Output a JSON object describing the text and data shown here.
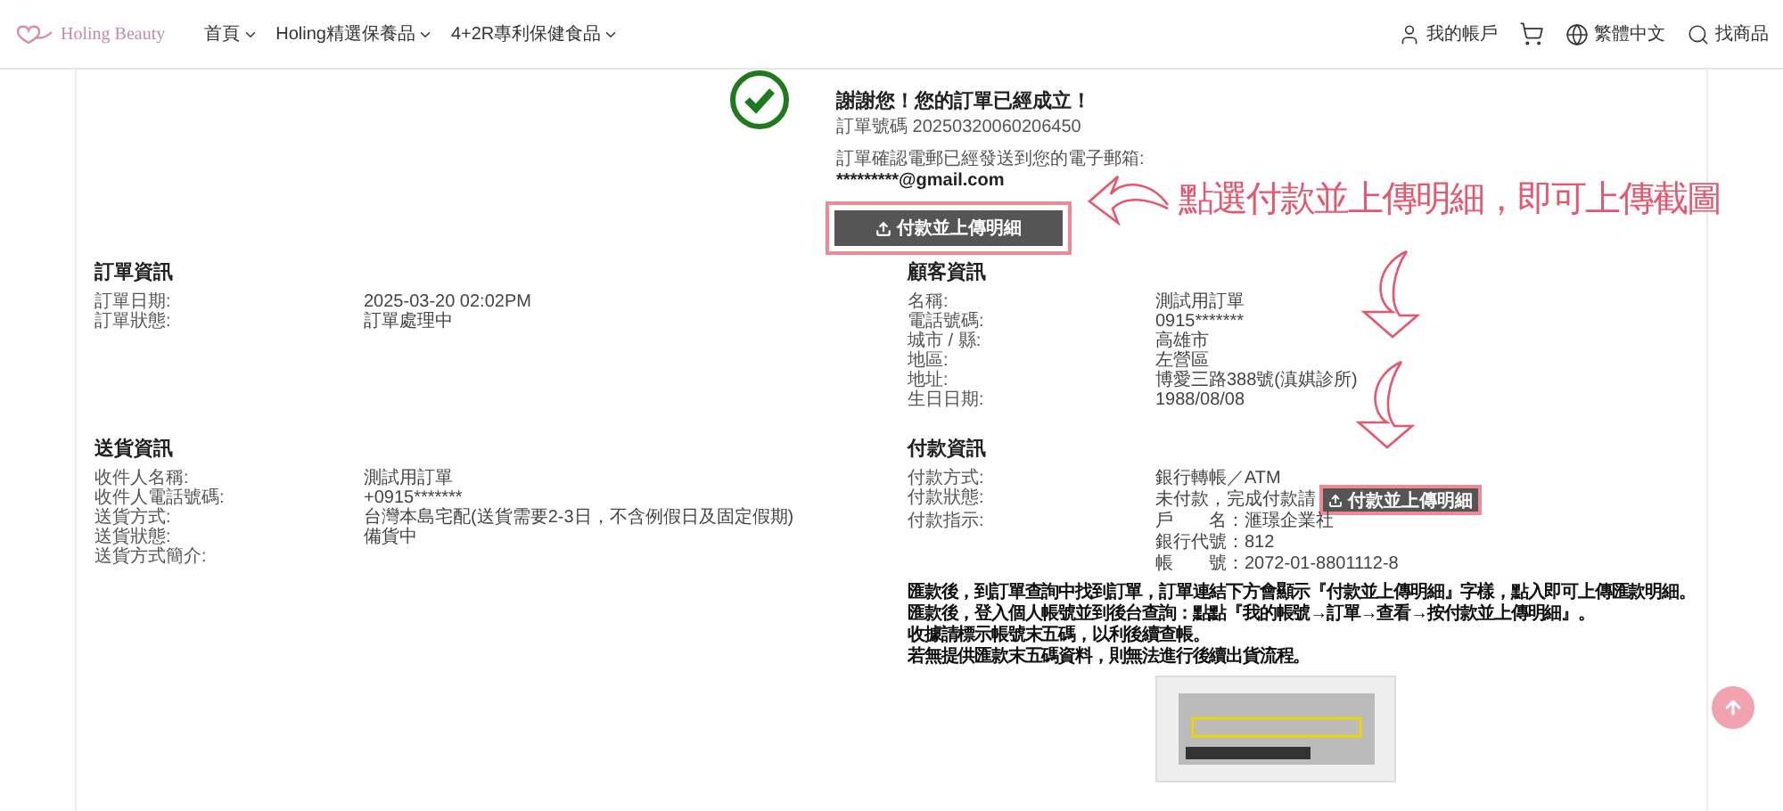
{
  "header": {
    "logo": "Holing Beauty",
    "nav": [
      {
        "label": "首頁",
        "has_menu": true
      },
      {
        "label": "Holing精選保養品",
        "has_menu": true
      },
      {
        "label": "4+2R專利保健食品",
        "has_menu": true
      }
    ],
    "actions": [
      {
        "kind": "account",
        "label": "我的帳戶"
      },
      {
        "kind": "cart"
      },
      {
        "kind": "language",
        "label": "繁體中文"
      },
      {
        "kind": "search",
        "label": "找商品"
      }
    ]
  },
  "confirmation": {
    "title": "謝謝您！您的訂單已經成立！",
    "order_number_label": "訂單號碼",
    "order_number": "20250320060206450",
    "email_note": "訂單確認電郵已經發送到您的電子郵箱:",
    "email": "*********@gmail.com",
    "upload_button": "付款並上傳明細"
  },
  "annotation": {
    "text": "點選付款並上傳明細，即可上傳截圖"
  },
  "left_sections": [
    {
      "title": "訂單資訊",
      "rows": [
        {
          "label": "訂單日期:",
          "values": [
            "2025-03-20 02:02PM"
          ]
        },
        {
          "label": "訂單狀態:",
          "values": [
            "訂單處理中"
          ]
        }
      ]
    },
    {
      "title": "送貨資訊",
      "rows": [
        {
          "label": "收件人名稱:",
          "values": [
            "測試用訂單"
          ]
        },
        {
          "label": "收件人電話號碼:",
          "values": [
            "+0915*******"
          ]
        },
        {
          "label": "送貨方式:",
          "values": [
            "台灣本島宅配(送貨需要2-3日，不含例假日及固定假期)"
          ]
        },
        {
          "label": "送貨狀態:",
          "values": [
            "備貨中"
          ]
        },
        {
          "label": "送貨方式簡介:",
          "values": []
        }
      ]
    }
  ],
  "right_sections": [
    {
      "title": "顧客資訊",
      "rows": [
        {
          "label": "名稱:",
          "values": [
            "測試用訂單"
          ]
        },
        {
          "label": "電話號碼:",
          "values": [
            "0915*******"
          ]
        },
        {
          "label": "城市 / 縣:",
          "values": [
            "高雄市"
          ]
        },
        {
          "label": "地區:",
          "values": [
            "左營區"
          ]
        },
        {
          "label": "地址:",
          "values": [
            "博愛三路388號(滇娸診所)"
          ]
        },
        {
          "label": "生日日期:",
          "values": [
            "1988/08/08"
          ]
        }
      ]
    },
    {
      "title": "付款資訊",
      "rows": [
        {
          "label": "付款方式:",
          "values": [
            "銀行轉帳／ATM"
          ]
        },
        {
          "label": "付款狀態:",
          "values": [
            "未付款，完成付款請"
          ],
          "button": "付款並上傳明細"
        },
        {
          "label": "付款指示:",
          "values": [
            "戶　　名：滙璟企業社",
            "銀行代號：812",
            "帳　　號：2072-01-8801112-8"
          ]
        }
      ]
    }
  ],
  "payment_notes": [
    "匯款後，到訂單查詢中找到訂單，訂單連結下方會顯示『付款並上傳明細』字樣，點入即可上傳匯款明細。",
    "匯款後，登入個人帳號並到後台查詢：點點『我的帳號→訂單→查看→按付款並上傳明細』。",
    "收據請標示帳號末五碼，以利後續查帳。",
    "若無提供匯款末五碼資料，則無法進行後續出貨流程。"
  ]
}
